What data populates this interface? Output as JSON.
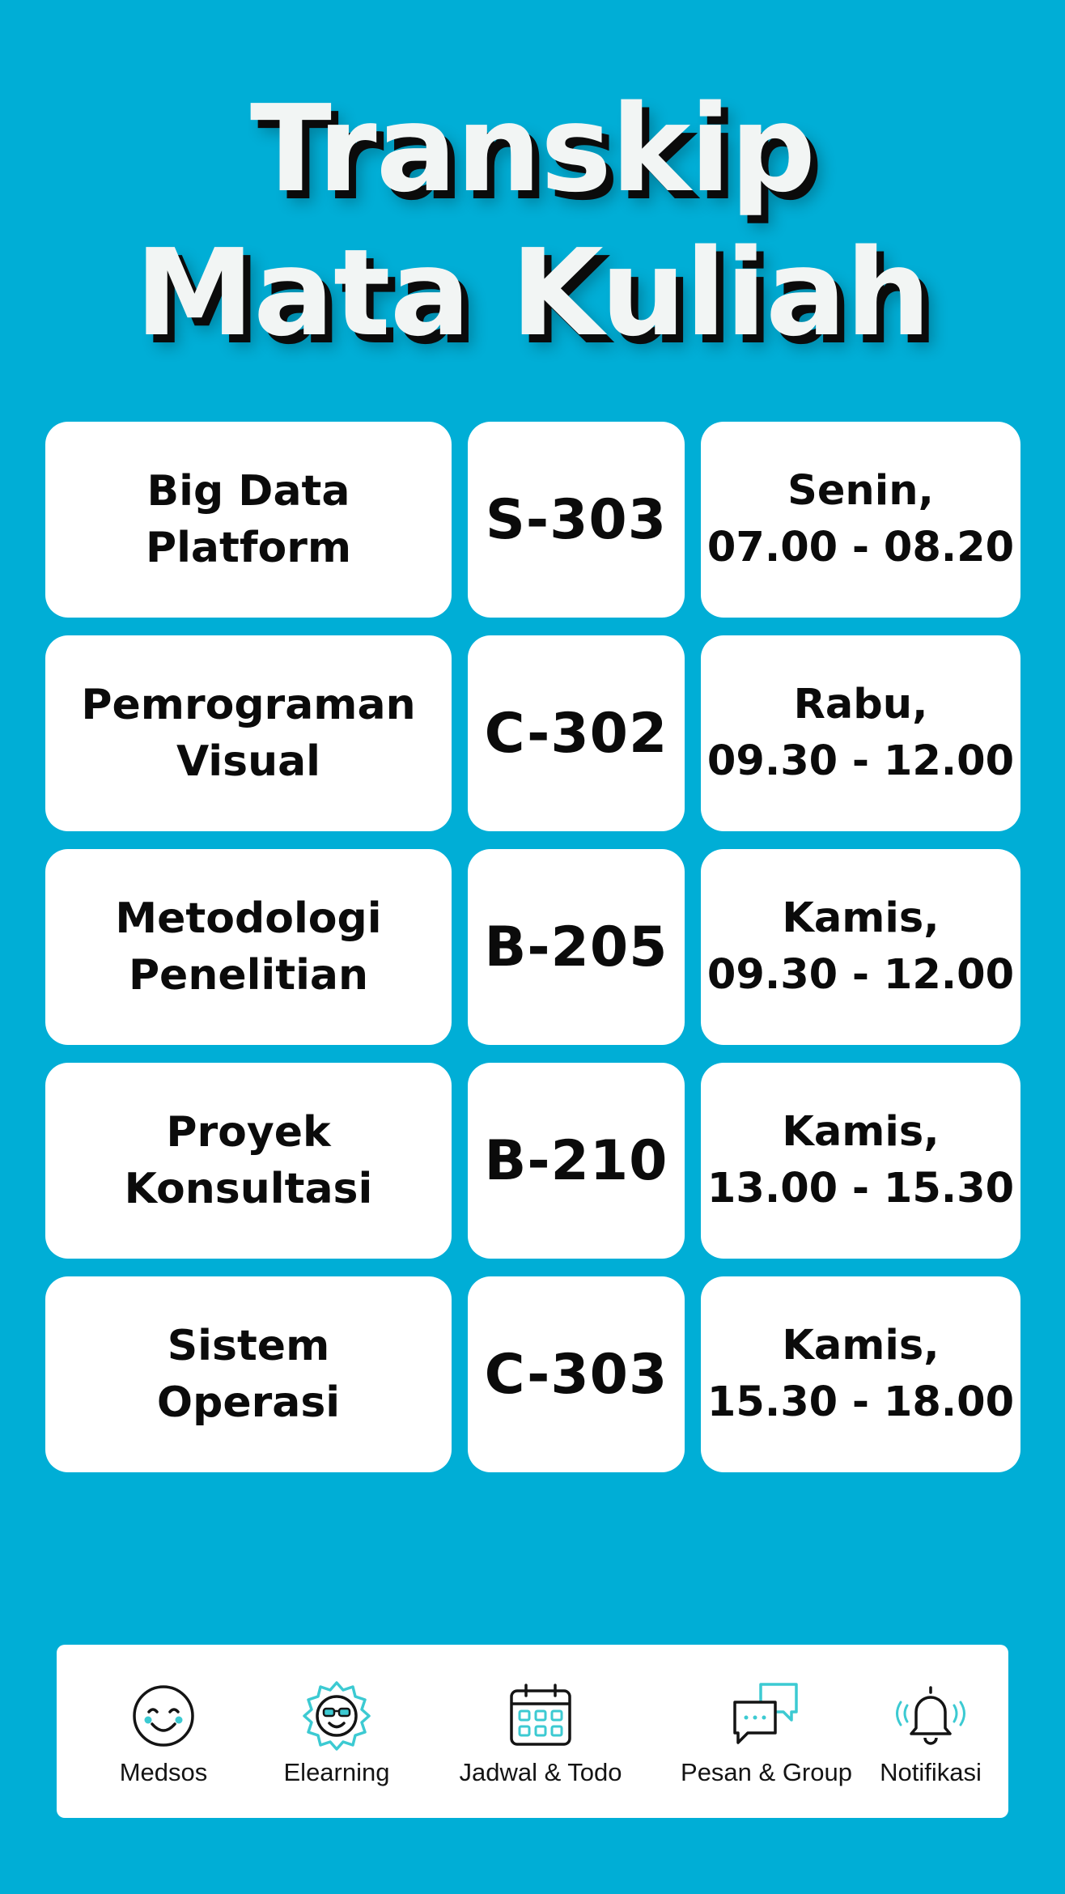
{
  "page": {
    "title_line1": "Transkip",
    "title_line2": "Mata Kuliah"
  },
  "courses": [
    {
      "name_line1": "Big Data",
      "name_line2": "Platform",
      "room": "S-303",
      "day": "Senin,",
      "time": "07.00 - 08.20"
    },
    {
      "name_line1": "Pemrograman",
      "name_line2": "Visual",
      "room": "C-302",
      "day": "Rabu,",
      "time": "09.30 - 12.00"
    },
    {
      "name_line1": "Metodologi",
      "name_line2": "Penelitian",
      "room": "B-205",
      "day": "Kamis,",
      "time": "09.30 - 12.00"
    },
    {
      "name_line1": "Proyek",
      "name_line2": "Konsultasi",
      "room": "B-210",
      "day": "Kamis,",
      "time": "13.00 - 15.30"
    },
    {
      "name_line1": "Sistem",
      "name_line2": "Operasi",
      "room": "C-303",
      "day": "Kamis,",
      "time": "15.30 - 18.00"
    }
  ],
  "nav": {
    "items": [
      {
        "label": "Medsos",
        "icon": "smiley-face-icon"
      },
      {
        "label": "Elearning",
        "icon": "sunglasses-face-badge-icon"
      },
      {
        "label": "Jadwal & Todo",
        "icon": "calendar-icon"
      },
      {
        "label": "Pesan & Group",
        "icon": "chat-bubbles-icon"
      },
      {
        "label": "Notifikasi",
        "icon": "bell-ringing-icon"
      }
    ]
  },
  "colors": {
    "background": "#00AED6",
    "card": "#FFFFFF",
    "title_text": "#F2F5F4",
    "accent_icon": "#3CCAD2"
  }
}
